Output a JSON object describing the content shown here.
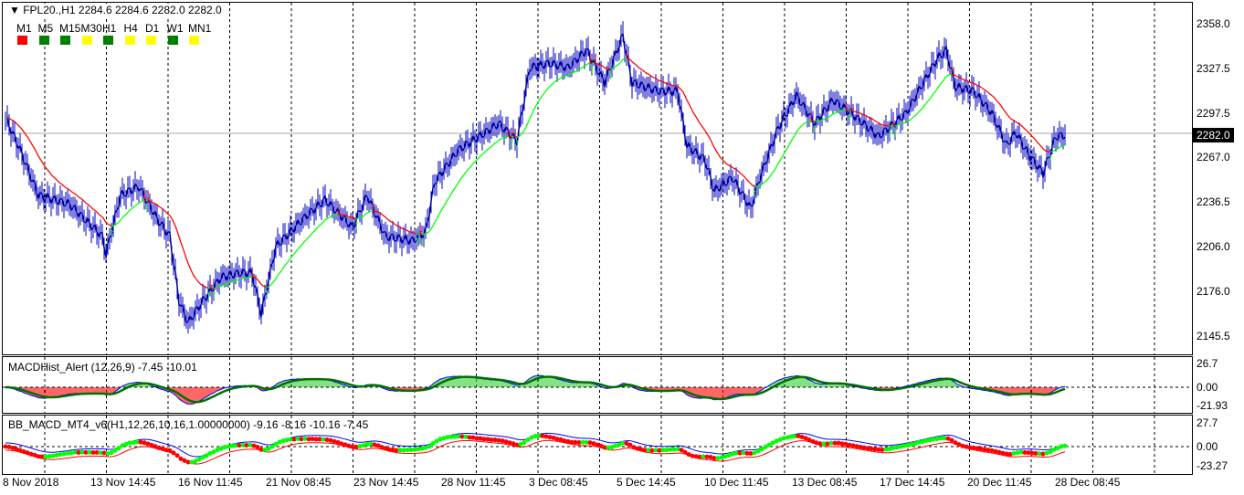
{
  "header": {
    "symbol_line": "FPL20.,H1  2284.6 2284.6 2282.0 2282.0"
  },
  "timeframes": [
    {
      "label": "M1",
      "color": "#ff0000"
    },
    {
      "label": "M5",
      "color": "#008000"
    },
    {
      "label": "M15",
      "color": "#008000"
    },
    {
      "label": "M30",
      "color": "#ffff00"
    },
    {
      "label": "H1",
      "color": "#008000"
    },
    {
      "label": "H4",
      "color": "#ffff00"
    },
    {
      "label": "D1",
      "color": "#ffff00"
    },
    {
      "label": "W1",
      "color": "#008000"
    },
    {
      "label": "MN1",
      "color": "#ffff00"
    }
  ],
  "price_axis": [
    "2358.0",
    "2327.5",
    "2297.5",
    "2267.0",
    "2236.5",
    "2206.0",
    "2176.0",
    "2145.5"
  ],
  "current_price": "2282.0",
  "ind1": {
    "title": "MACDHist_Alert (12,26,9)  -7.45 -10.01",
    "axis": [
      "26.7",
      "0.00",
      "-21.93"
    ]
  },
  "ind2": {
    "title": "BB_MACD_MT4_v6(H1,12,26,10,16,1.00000000) -9.16 -8.16 -10.16 -7.45",
    "axis": [
      "27.7",
      "0.00",
      "-23.27"
    ]
  },
  "time_axis": [
    "8 Nov 2018",
    "13 Nov 14:45",
    "16 Nov 11:45",
    "21 Nov 08:45",
    "23 Nov 14:45",
    "28 Nov 11:45",
    "3 Dec 08:45",
    "5 Dec 14:45",
    "10 Dec 11:45",
    "13 Dec 08:45",
    "17 Dec 14:45",
    "20 Dec 11:45",
    "28 Dec 08:45"
  ],
  "chart_data": {
    "type": "line",
    "ylim": [
      2140,
      2362
    ],
    "bars": [
      0,
      8,
      18,
      35,
      53,
      55,
      63,
      73,
      83,
      90,
      95,
      100,
      108,
      118,
      128,
      135,
      140,
      148,
      163,
      175,
      190,
      198,
      208,
      223,
      230,
      235,
      248,
      263,
      270,
      280,
      287,
      298,
      308,
      318,
      328,
      338,
      343,
      350,
      358,
      368,
      373,
      383,
      388,
      398,
      408,
      413,
      423,
      433,
      443,
      453,
      463,
      478,
      493,
      503,
      510,
      515,
      520,
      530,
      540,
      548,
      553,
      560,
      568,
      575,
      580
    ],
    "close": [
      2294,
      2272,
      2241,
      2235,
      2213,
      2201,
      2241,
      2247,
      2225,
      2213,
      2169,
      2154,
      2169,
      2185,
      2188,
      2188,
      2160,
      2206,
      2225,
      2238,
      2219,
      2241,
      2213,
      2210,
      2216,
      2250,
      2272,
      2284,
      2290,
      2278,
      2328,
      2331,
      2328,
      2340,
      2318,
      2350,
      2318,
      2315,
      2312,
      2312,
      2275,
      2265,
      2244,
      2253,
      2232,
      2253,
      2287,
      2309,
      2290,
      2306,
      2297,
      2281,
      2297,
      2319,
      2334,
      2340,
      2315,
      2312,
      2297,
      2275,
      2284,
      2269,
      2256,
      2281,
      2282
    ]
  }
}
